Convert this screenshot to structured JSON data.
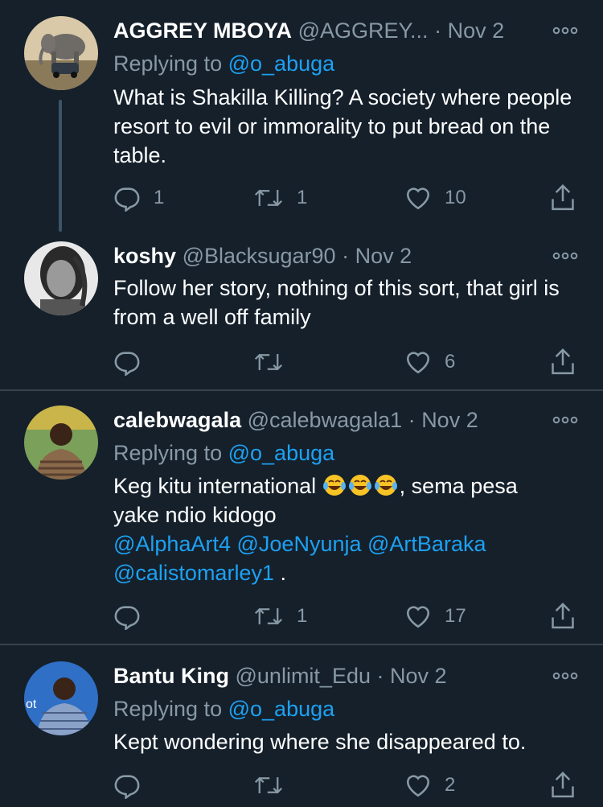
{
  "tweets": [
    {
      "name": "AGGREY MBOYA",
      "handle": "@AGGREY...",
      "dot": "·",
      "date": "Nov 2",
      "replying_label": "Replying to",
      "replying_to": "@o_abuga",
      "body": "What is Shakilla Killing? A society where people resort to evil or immorality to put bread on the table.",
      "replies": "1",
      "retweets": "1",
      "likes": "10"
    },
    {
      "name": "koshy",
      "handle": "@Blacksugar90",
      "dot": "·",
      "date": "Nov 2",
      "body": "Follow her story, nothing of this sort, that girl is from a well off family",
      "replies": "",
      "retweets": "",
      "likes": "6"
    },
    {
      "name": "calebwagala",
      "handle": "@calebwagala1",
      "dot": "·",
      "date": "Nov 2",
      "replying_label": "Replying to",
      "replying_to": "@o_abuga",
      "body_start": "Keg kitu international ",
      "emoji": "face-with-tears-of-joy x3",
      "body_after_emoji": ", sema pesa",
      "body_line2": "yake ndio kidogo",
      "mentions": [
        "@AlphaArt4",
        "@JoeNyunja",
        "@ArtBaraka",
        "@calistomarley1"
      ],
      "mentions_end": " .",
      "replies": "",
      "retweets": "1",
      "likes": "17"
    },
    {
      "name": "Bantu King",
      "handle": "@unlimit_Edu",
      "dot": "·",
      "date": "Nov 2",
      "replying_label": "Replying to",
      "replying_to": "@o_abuga",
      "body": "Kept wondering where she disappeared to.",
      "replies": "",
      "retweets": "",
      "likes": "2"
    }
  ],
  "colors": {
    "background": "#15202b",
    "secondary_text": "#8899a6",
    "link": "#1da1f2",
    "divider": "#38444d"
  },
  "icons": [
    "reply-icon",
    "retweet-icon",
    "like-icon",
    "share-icon",
    "more-icon"
  ]
}
